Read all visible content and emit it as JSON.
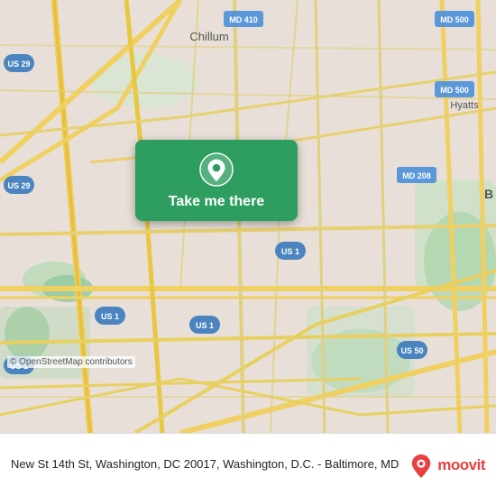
{
  "map": {
    "background_color": "#e8e0d8",
    "osm_credit": "© OpenStreetMap contributors"
  },
  "button": {
    "label": "Take me there",
    "background_color": "#2d9e5f",
    "pin_color": "#ffffff"
  },
  "bottom_bar": {
    "address": "New St 14th St, Washington, DC 20017, Washington, D.C. - Baltimore, MD",
    "logo_name": "moovit"
  }
}
